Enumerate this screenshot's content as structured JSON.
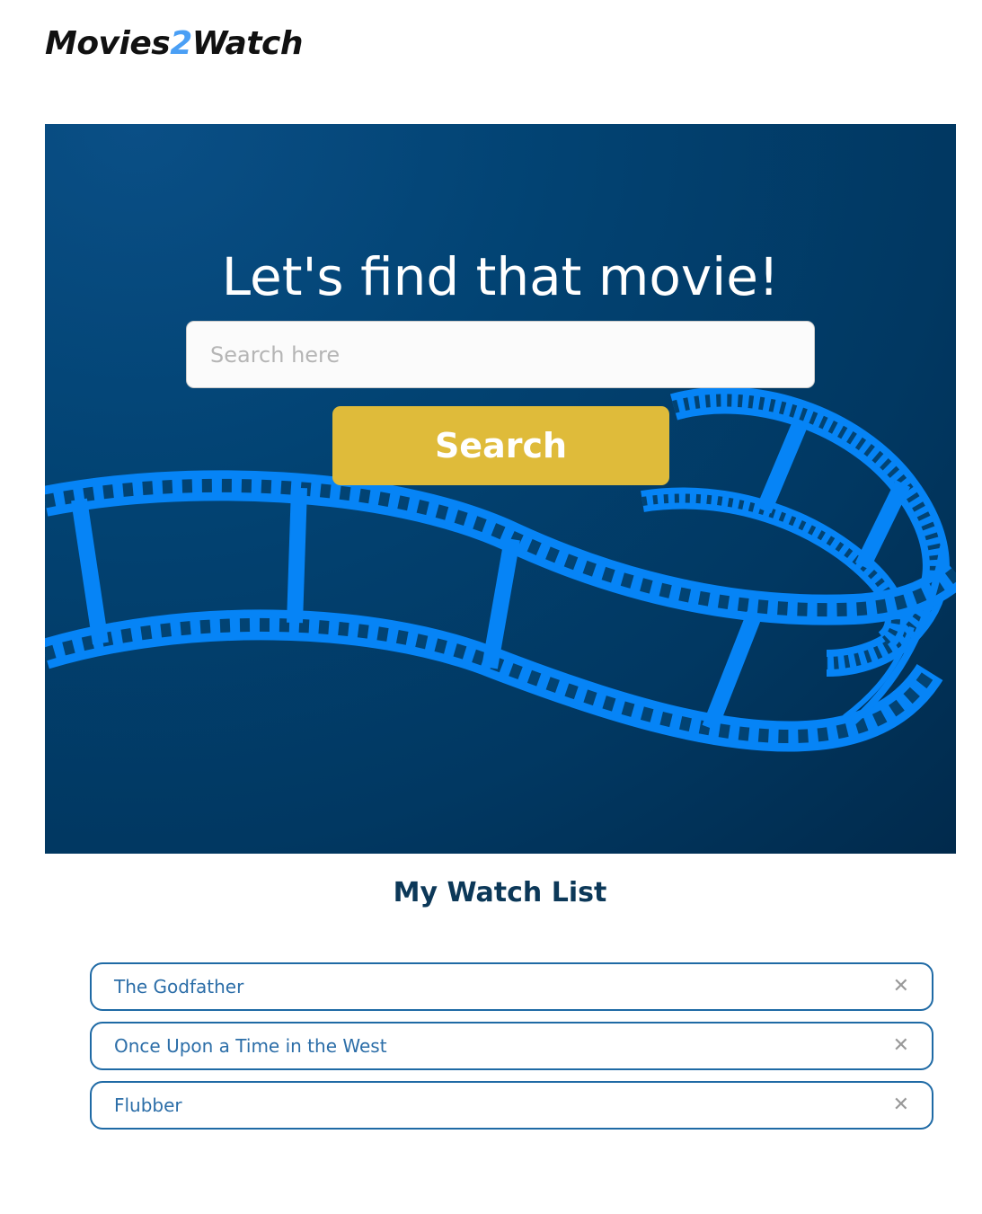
{
  "header": {
    "logo_part1": "Movies",
    "logo_accent": "2",
    "logo_part2": "Watch",
    "accent_color": "#4a9ff5"
  },
  "hero": {
    "title": "Let's find that movie!",
    "search_placeholder": "Search here",
    "search_value": "",
    "search_button_label": "Search",
    "background_color": "#024373",
    "film_color": "#0684f6",
    "button_color": "#dfbb3a"
  },
  "watchlist": {
    "title": "My Watch List",
    "items": [
      {
        "label": "The Godfather",
        "remove_icon": "close-icon"
      },
      {
        "label": "Once Upon a Time in the West",
        "remove_icon": "close-icon"
      },
      {
        "label": "Flubber",
        "remove_icon": "close-icon"
      }
    ],
    "remove_glyph": "✕",
    "border_color": "#1f6aa5"
  }
}
